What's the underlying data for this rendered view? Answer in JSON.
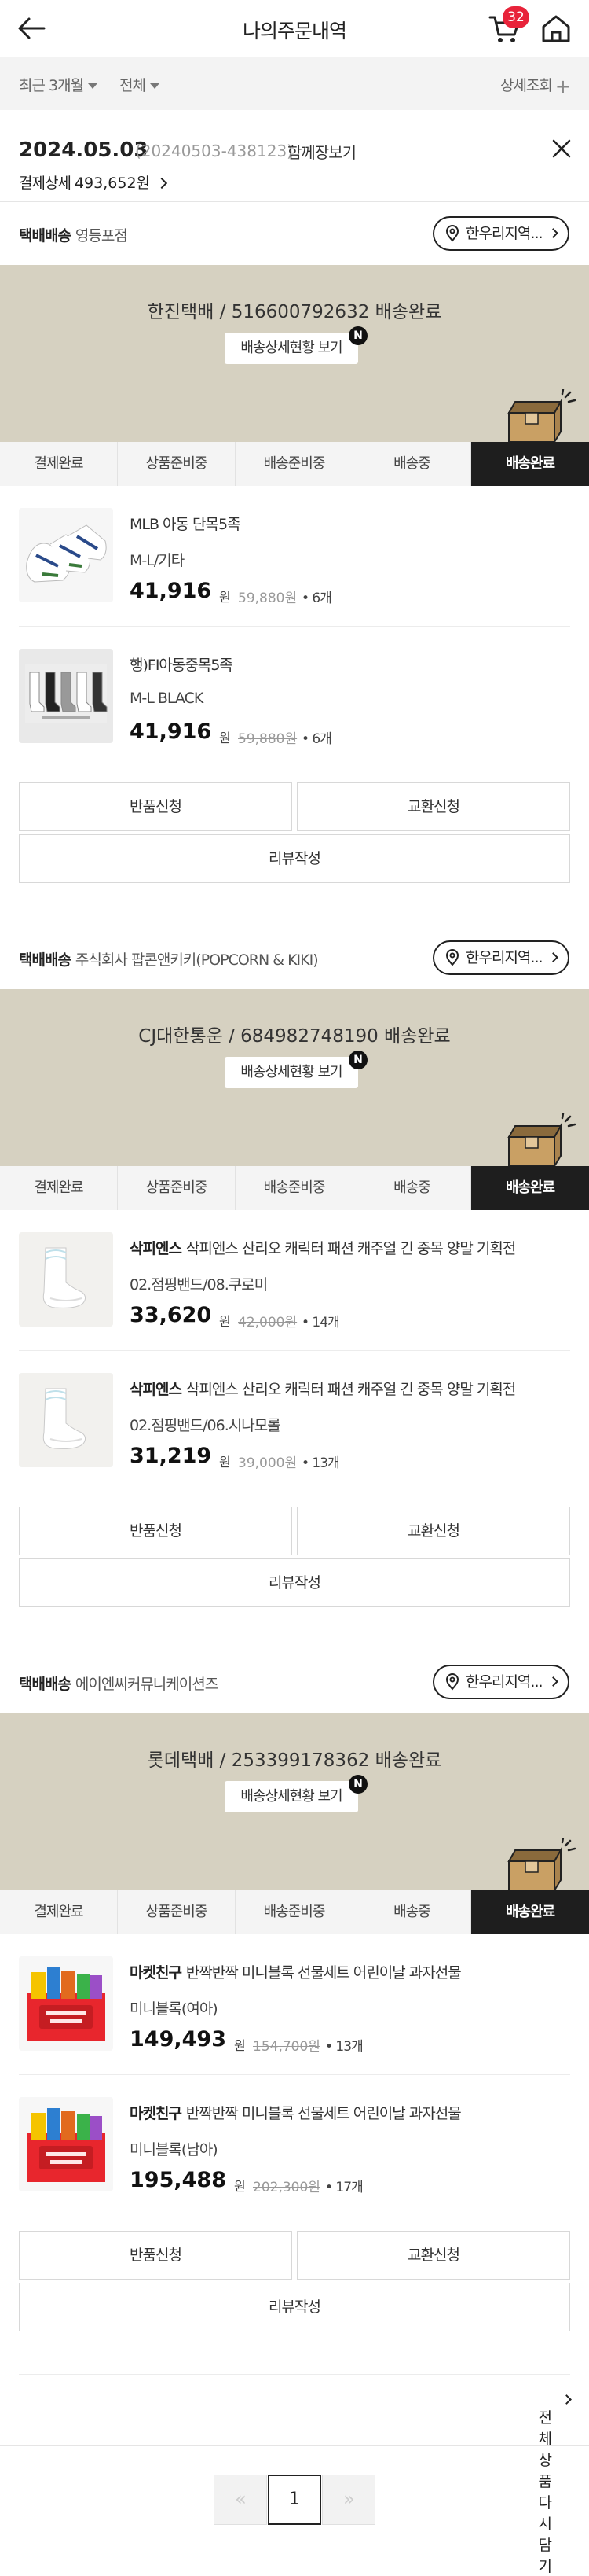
{
  "header": {
    "title": "나의주문내역",
    "cart_count": "32"
  },
  "filter": {
    "period": "최근 3개월",
    "type": "전체",
    "detail": "상세조회"
  },
  "order": {
    "date": "2024.05.03",
    "order_no": "(20240503-438123)",
    "ship_together": "함께장보기",
    "pay_label": "결제상세",
    "pay_amount": "493,652원"
  },
  "steps": [
    "결제완료",
    "상품준비중",
    "배송준비중",
    "배송중",
    "배송완료"
  ],
  "common": {
    "delivery_type": "택배배송",
    "nearby": "한우리지역...",
    "tracking_button": "배송상세현황 보기",
    "new_badge": "N",
    "won": "원",
    "return_button": "반품신청",
    "exchange_button": "교환신청",
    "review_button": "리뷰작성"
  },
  "groups": [
    {
      "seller": "영등포점",
      "tracking": "한진택배 / 516600792632 배송완료",
      "items": [
        {
          "brand": "",
          "name": "MLB 아동 단목5족",
          "option": "M-L/기타",
          "price": "41,916",
          "orig": "59,880원",
          "qty": "• 6개"
        },
        {
          "brand": "",
          "name": "행)FI아동중목5족",
          "option": "M-L BLACK",
          "price": "41,916",
          "orig": "59,880원",
          "qty": "• 6개"
        }
      ]
    },
    {
      "seller": "주식회사 팝콘앤키키(POPCORN & KIKI)",
      "tracking": "CJ대한통운 / 684982748190 배송완료",
      "items": [
        {
          "brand": "삭피엔스",
          "name": "삭피엔스 산리오 캐릭터 패션 캐주얼 긴 중목 양말 기획전",
          "option": "02.점핑밴드/08.쿠로미",
          "price": "33,620",
          "orig": "42,000원",
          "qty": "• 14개"
        },
        {
          "brand": "삭피엔스",
          "name": "삭피엔스 산리오 캐릭터 패션 캐주얼 긴 중목 양말 기획전",
          "option": "02.점핑밴드/06.시나모롤",
          "price": "31,219",
          "orig": "39,000원",
          "qty": "• 13개"
        }
      ]
    },
    {
      "seller": "에이엔씨커뮤니케이션즈",
      "tracking": "롯데택배 / 253399178362 배송완료",
      "items": [
        {
          "brand": "마켓친구",
          "name": "반짝반짝 미니블록 선물세트 어린이날 과자선물",
          "option": "미니블록(여아)",
          "price": "149,493",
          "orig": "154,700원",
          "qty": "• 13개"
        },
        {
          "brand": "마켓친구",
          "name": "반짝반짝 미니블록 선물세트 어린이날 과자선물",
          "option": "미니블록(남아)",
          "price": "195,488",
          "orig": "202,300원",
          "qty": "• 17개"
        }
      ]
    }
  ],
  "footer": {
    "reorder": "전체상품 다시담기",
    "prev": "«",
    "page": "1",
    "next": "»"
  }
}
